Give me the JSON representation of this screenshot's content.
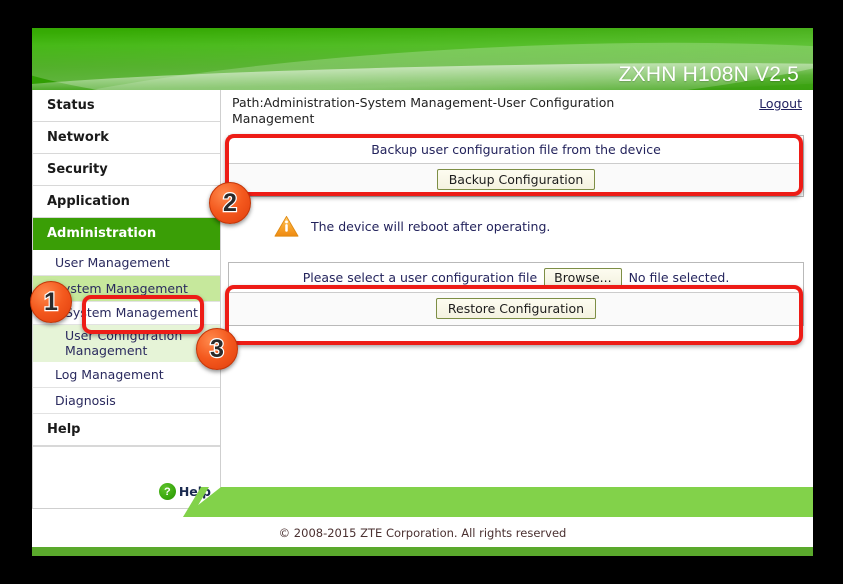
{
  "header": {
    "model": "ZXHN H108N V2.5"
  },
  "path": {
    "text": "Path:Administration-System Management-User Configuration Management",
    "logout": "Logout"
  },
  "sidebar": {
    "items": [
      {
        "label": "Status",
        "level": "top"
      },
      {
        "label": "Network",
        "level": "top"
      },
      {
        "label": "Security",
        "level": "top"
      },
      {
        "label": "Application",
        "level": "top"
      },
      {
        "label": "Administration",
        "level": "top",
        "state": "active"
      },
      {
        "label": "User Management",
        "level": "sub"
      },
      {
        "label": "System Management",
        "level": "sub",
        "state": "selected"
      },
      {
        "label": "System Management",
        "level": "sub2"
      },
      {
        "label": "User Configuration Management",
        "level": "sub2",
        "state": "highlighted"
      },
      {
        "label": "Log Management",
        "level": "sub"
      },
      {
        "label": "Diagnosis",
        "level": "sub"
      },
      {
        "label": "Help",
        "level": "top"
      }
    ],
    "help_button": {
      "label": "Help",
      "icon": "question-mark-icon"
    }
  },
  "backup_panel": {
    "title": "Backup user configuration file from the device",
    "button": "Backup Configuration"
  },
  "notice": {
    "icon": "warning-triangle-icon",
    "text": "The device will reboot after operating."
  },
  "restore_panel": {
    "label": "Please select a user configuration file",
    "browse_button": "Browse...",
    "file_status": "No file selected.",
    "button": "Restore Configuration"
  },
  "annotations": {
    "badges": [
      {
        "number": "1"
      },
      {
        "number": "2"
      },
      {
        "number": "3"
      }
    ]
  },
  "footer": {
    "copyright": "© 2008-2015 ZTE Corporation. All rights reserved"
  },
  "colors": {
    "brand_green": "#3a9e06",
    "banner_green": "#35a803",
    "light_green": "#c6e89c",
    "pale_green": "#e6f4d7",
    "footer_green": "#82d24a",
    "footer_bar": "#5aa92c",
    "annotation_red": "#ed1c16",
    "badge_orange": "#f4591e",
    "warning_orange": "#f5a623"
  }
}
